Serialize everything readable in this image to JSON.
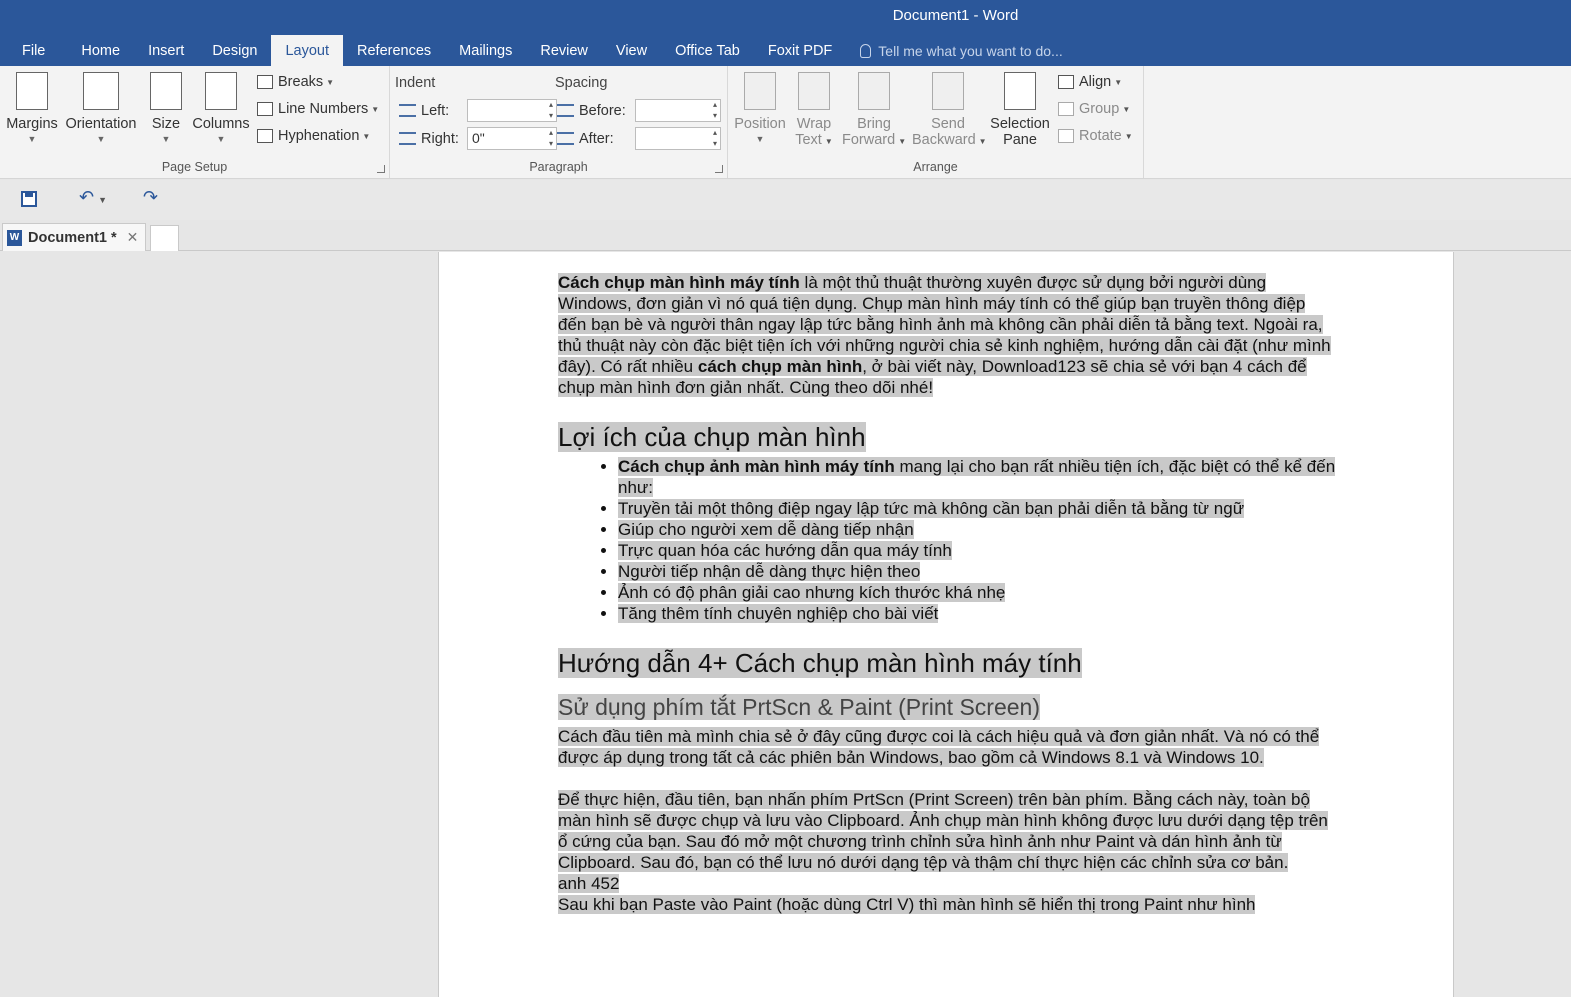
{
  "window": {
    "title": "Document1 - Word"
  },
  "tabs": [
    {
      "label": "File"
    },
    {
      "label": "Home"
    },
    {
      "label": "Insert"
    },
    {
      "label": "Design"
    },
    {
      "label": "Layout"
    },
    {
      "label": "References"
    },
    {
      "label": "Mailings"
    },
    {
      "label": "Review"
    },
    {
      "label": "View"
    },
    {
      "label": "Office Tab"
    },
    {
      "label": "Foxit PDF"
    }
  ],
  "active_tab": "Layout",
  "tell_me": "Tell me what you want to do...",
  "ribbon": {
    "page_setup": {
      "label": "Page Setup",
      "margins": "Margins",
      "orientation": "Orientation",
      "size": "Size",
      "columns": "Columns",
      "breaks": "Breaks",
      "line_numbers": "Line Numbers",
      "hyphenation": "Hyphenation"
    },
    "paragraph": {
      "label": "Paragraph",
      "indent": "Indent",
      "spacing": "Spacing",
      "left_label": "Left:",
      "left_value": "",
      "right_label": "Right:",
      "right_value": "0\"",
      "before_label": "Before:",
      "before_value": "",
      "after_label": "After:",
      "after_value": ""
    },
    "arrange": {
      "label": "Arrange",
      "position": "Position",
      "wrap_text_1": "Wrap",
      "wrap_text_2": "Text",
      "bring_forward_1": "Bring",
      "bring_forward_2": "Forward",
      "send_backward_1": "Send",
      "send_backward_2": "Backward",
      "selection_pane_1": "Selection",
      "selection_pane_2": "Pane",
      "align": "Align",
      "group": "Group",
      "rotate": "Rotate"
    }
  },
  "doc_tab": {
    "name": "Document1 *"
  },
  "document": {
    "intro_bold_1": "Cách chụp màn hình máy tính",
    "intro_1": " là một thủ thuật thường xuyên được sử dụng bởi người dùng Windows, đơn giản vì nó quá tiện dụng. Chụp màn hình máy tính có thể giúp bạn truyền thông điệp đến bạn bè và người thân ngay lập tức bằng hình ảnh mà không cần phải diễn tả bằng text. Ngoài ra, thủ thuật này còn đặc biệt tiện ích với những người chia sẻ kinh nghiệm, hướng dẫn cài đặt (như mình đây). Có rất nhiều ",
    "intro_bold_2": "cách chụp màn hình",
    "intro_2": ", ở bài viết này, Download123 sẽ chia sẻ với bạn 4 cách để chụp màn hình đơn giản nhất. Cùng theo dõi nhé!",
    "heading_1": "Lợi ích của chụp màn hình",
    "bullet_0_bold": "Cách chụp ảnh màn hình máy tính",
    "bullet_0_rest": " mang lại cho bạn rất nhiều tiện ích, đặc biệt có thể kể đến như:",
    "bullets": [
      "Truyền tải một thông điệp ngay lập tức mà không cần bạn phải diễn tả bằng từ ngữ",
      "Giúp cho người xem dễ dàng tiếp nhận",
      "Trực quan hóa các hướng dẫn qua máy tính",
      "Người tiếp nhận dễ dàng thực hiện theo",
      "Ảnh có độ phân giải cao nhưng kích thước khá nhẹ",
      "Tăng thêm tính chuyên nghiệp cho bài viết"
    ],
    "heading_2": "Hướng dẫn 4+ Cách chụp màn hình máy tính",
    "heading_3": "Sử dụng phím tắt PrtScn & Paint (Print Screen)",
    "para_1": "Cách đầu tiên mà mình chia sẻ ở đây cũng được coi là cách hiệu quả và đơn giản nhất. Và nó có thể được áp dụng trong tất cả các phiên bản Windows, bao gồm cả Windows 8.1 và Windows 10.",
    "para_2": "Để thực hiện, đầu tiên, bạn nhấn phím PrtScn (Print Screen) trên bàn phím. Bằng cách này, toàn bộ màn hình sẽ được chụp và lưu vào Clipboard. Ảnh chụp màn hình không được lưu dưới dạng tệp trên ổ cứng của bạn. Sau đó mở một chương trình chỉnh sửa hình ảnh như Paint và dán hình ảnh từ Clipboard. Sau đó, bạn có thể lưu nó dưới dạng tệp và thậm chí thực hiện các chỉnh sửa cơ bản.",
    "para_3": "anh 452",
    "para_4": "Sau khi bạn Paste vào Paint (hoặc dùng Ctrl V) thì màn hình sẽ hiển thị trong Paint như hình"
  },
  "colors": {
    "titlebar": "#2b579a",
    "ribbon": "#f3f3f3",
    "selection": "#c9c9c9"
  }
}
